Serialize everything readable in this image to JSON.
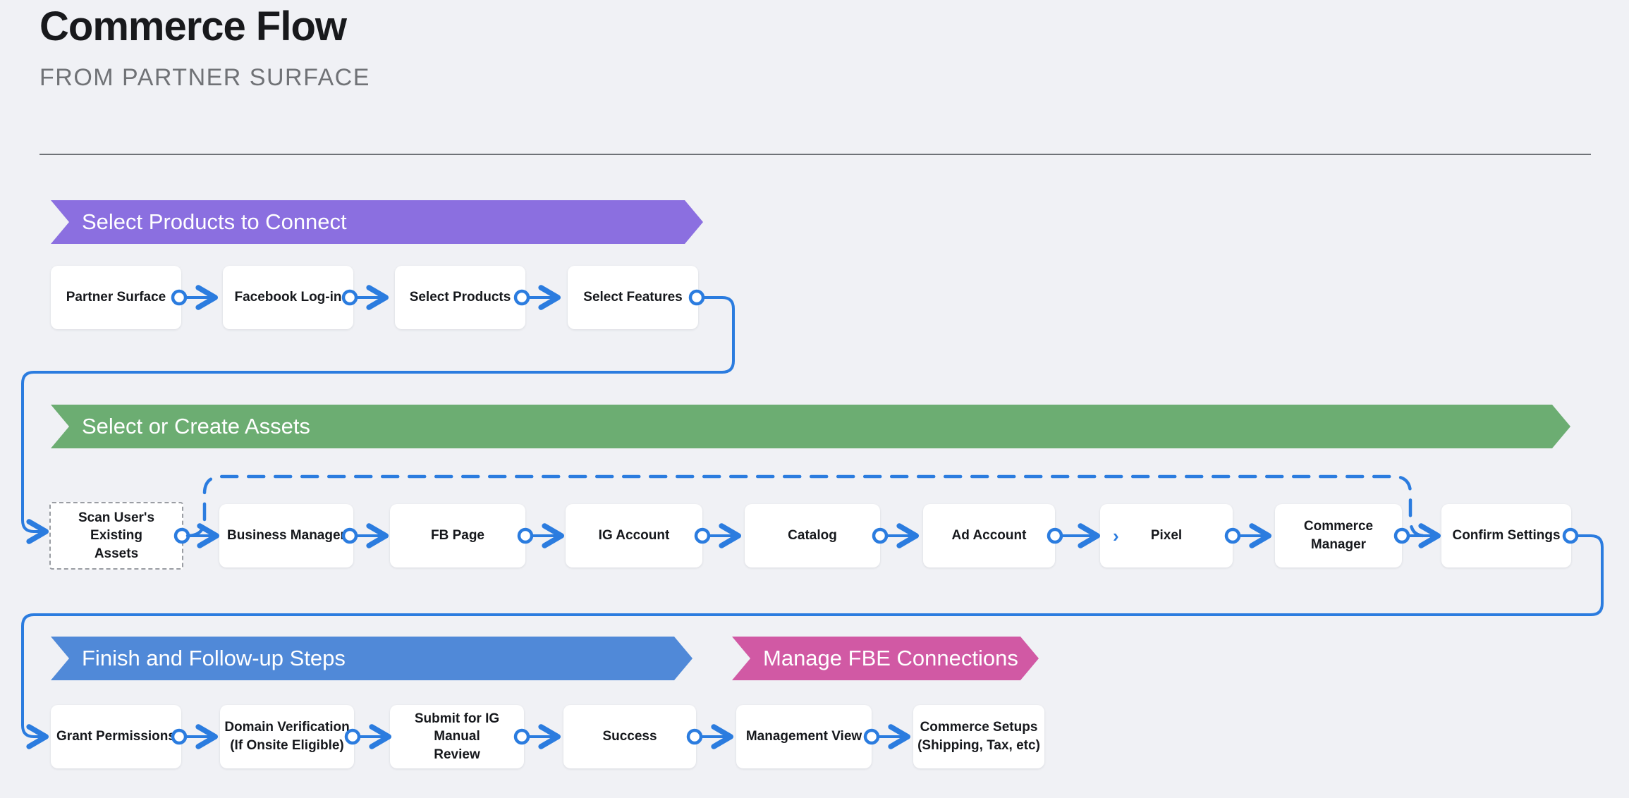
{
  "header": {
    "title": "Commerce Flow",
    "subtitle": "FROM PARTNER SURFACE"
  },
  "colors": {
    "background": "#f0f1f5",
    "connector_blue": "#2b7cdf",
    "banner_purple": "#8b6fe0",
    "banner_green": "#6cad72",
    "banner_blue": "#5089d8",
    "banner_pink": "#d159a4",
    "node_text": "#16181c",
    "dashed_border": "#9a9da3"
  },
  "sections": [
    {
      "id": "select-products-to-connect",
      "banner_label": "Select Products to Connect",
      "banner_color": "#8b6fe0",
      "nodes": [
        {
          "label": "Partner Surface",
          "style": "solid"
        },
        {
          "label": "Facebook Log-in",
          "style": "solid"
        },
        {
          "label": "Select Products",
          "style": "solid"
        },
        {
          "label": "Select Features",
          "style": "solid"
        }
      ]
    },
    {
      "id": "select-or-create-assets",
      "banner_label": "Select or Create Assets",
      "banner_color": "#6cad72",
      "nodes": [
        {
          "label": "Scan User's Existing Assets",
          "style": "dashed"
        },
        {
          "label": "Business Manager",
          "style": "solid"
        },
        {
          "label": "FB Page",
          "style": "solid"
        },
        {
          "label": "IG Account",
          "style": "solid"
        },
        {
          "label": "Catalog",
          "style": "solid"
        },
        {
          "label": "Ad Account",
          "style": "solid"
        },
        {
          "label": "Pixel",
          "style": "solid",
          "inner_chevron": "›"
        },
        {
          "label": "Commerce Manager",
          "style": "solid"
        },
        {
          "label": "Confirm Settings",
          "style": "solid"
        }
      ]
    },
    {
      "id": "finish-and-follow-up-steps",
      "banner_label": "Finish and Follow-up Steps",
      "banner_color": "#5089d8",
      "nodes": [
        {
          "label": "Grant Permissions",
          "style": "solid"
        },
        {
          "label": "Domain Verification\n(If Onsite Eligible)",
          "style": "solid"
        },
        {
          "label": "Submit for IG Manual\nReview",
          "style": "solid"
        },
        {
          "label": "Success",
          "style": "solid"
        },
        {
          "label": "Management View",
          "style": "solid"
        },
        {
          "label": "Commerce Setups\n(Shipping, Tax, etc)",
          "style": "solid"
        }
      ]
    },
    {
      "id": "manage-fbe-connections",
      "banner_label": "Manage FBE Connections",
      "banner_color": "#d159a4"
    }
  ],
  "nodes": {
    "partner_surface": "Partner Surface",
    "facebook_login": "Facebook Log-in",
    "select_products": "Select Products",
    "select_features": "Select Features",
    "scan_assets_line1": "Scan User's Existing",
    "scan_assets_line2": "Assets",
    "business_manager": "Business Manager",
    "fb_page": "FB Page",
    "ig_account": "IG Account",
    "catalog": "Catalog",
    "ad_account": "Ad Account",
    "pixel": "Pixel",
    "pixel_chevron": "›",
    "commerce_manager": "Commerce Manager",
    "confirm_settings": "Confirm Settings",
    "grant_permissions": "Grant Permissions",
    "domain_verification_line1": "Domain Verification",
    "domain_verification_line2": "(If Onsite Eligible)",
    "submit_ig_review_line1": "Submit for IG Manual",
    "submit_ig_review_line2": "Review",
    "success": "Success",
    "management_view": "Management View",
    "commerce_setups_line1": "Commerce Setups",
    "commerce_setups_line2": "(Shipping, Tax, etc)"
  }
}
